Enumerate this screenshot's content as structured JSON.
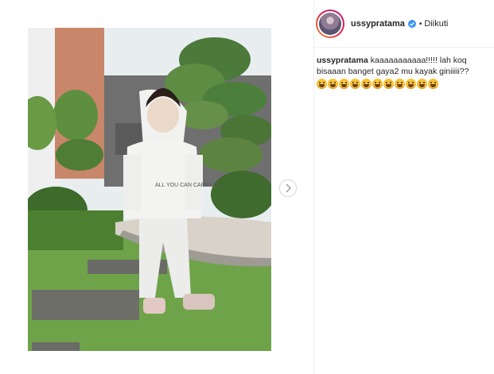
{
  "post": {
    "username": "ussypratama",
    "verified": true,
    "separator": "•",
    "follow_status": "Diikuti",
    "caption_user": "ussypratama",
    "caption_text": "kaaaaaaaaaaa!!!!! lah koq bisaaan banget gaya2 mu kayak giniiiii??",
    "emoji_count": 11,
    "emoji_name": "grinning-face-emoji",
    "hoodie_text": "ALL YOU CAN CARRY BE"
  },
  "colors": {
    "avatar_ring": "#dc2743",
    "verified": "#3897f0"
  },
  "icons": {
    "next": "chevron-right-icon",
    "verified": "verified-badge-icon"
  }
}
